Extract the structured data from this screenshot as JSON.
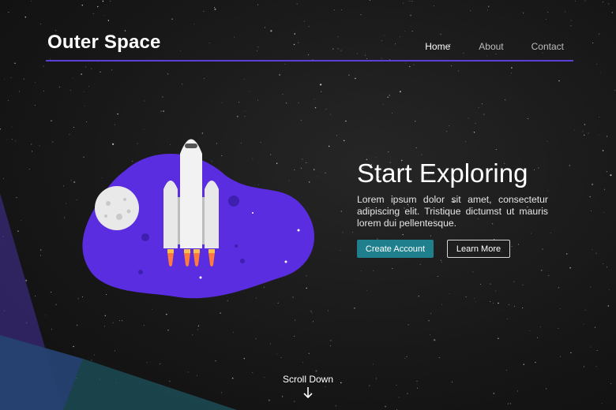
{
  "header": {
    "brand": "Outer Space",
    "nav": [
      {
        "label": "Home",
        "active": true
      },
      {
        "label": "About",
        "active": false
      },
      {
        "label": "Contact",
        "active": false
      }
    ]
  },
  "hero": {
    "title": "Start Exploring",
    "body": "Lorem ipsum dolor sit amet, consectetur adipiscing elit. Tristique dictumst ut mauris lorem dui pellentesque.",
    "primary_button": "Create Account",
    "secondary_button": "Learn More"
  },
  "scroll": {
    "label": "Scroll Down",
    "icon": "arrow-down-icon"
  },
  "illustration": {
    "icons": [
      "rocket-icon",
      "moon-icon",
      "planet-blob"
    ]
  },
  "colors": {
    "accent": "#5b3fd6",
    "primary_button": "#1f7f8c",
    "blob": "#5a2de0",
    "background": "#181818"
  }
}
